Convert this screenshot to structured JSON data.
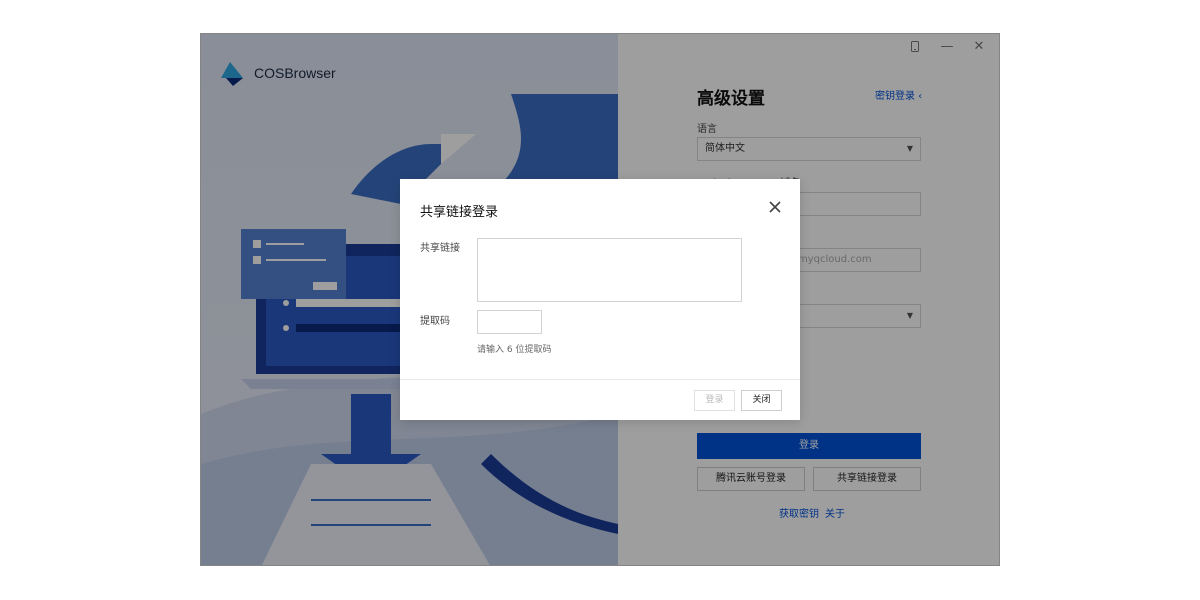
{
  "app": {
    "name": "COSBrowser"
  },
  "window_controls": {
    "device_icon": "mobile-icon",
    "minimize": "—",
    "close": "✕"
  },
  "settings": {
    "title": "高级设置",
    "key_login_link": "密钥登录 ‹",
    "language_label": "语言",
    "language_value": "简体中文",
    "endpoint_label": "EndPoint/Server 域名",
    "endpoint_placeholder": "myqcloud.com",
    "login_button": "登录",
    "tencent_login": "腾讯云账号登录",
    "share_link_login": "共享链接登录",
    "get_key_link": "获取密钥",
    "about_link": "关于"
  },
  "dialog": {
    "title": "共享链接登录",
    "link_label": "共享链接",
    "link_value": "",
    "code_label": "提取码",
    "code_value": "",
    "code_hint": "请输入 6 位提取码",
    "login_button": "登录",
    "close_button": "关闭"
  },
  "colors": {
    "accent": "#0052d9",
    "overlay": "rgba(0,0,0,0.38)"
  }
}
